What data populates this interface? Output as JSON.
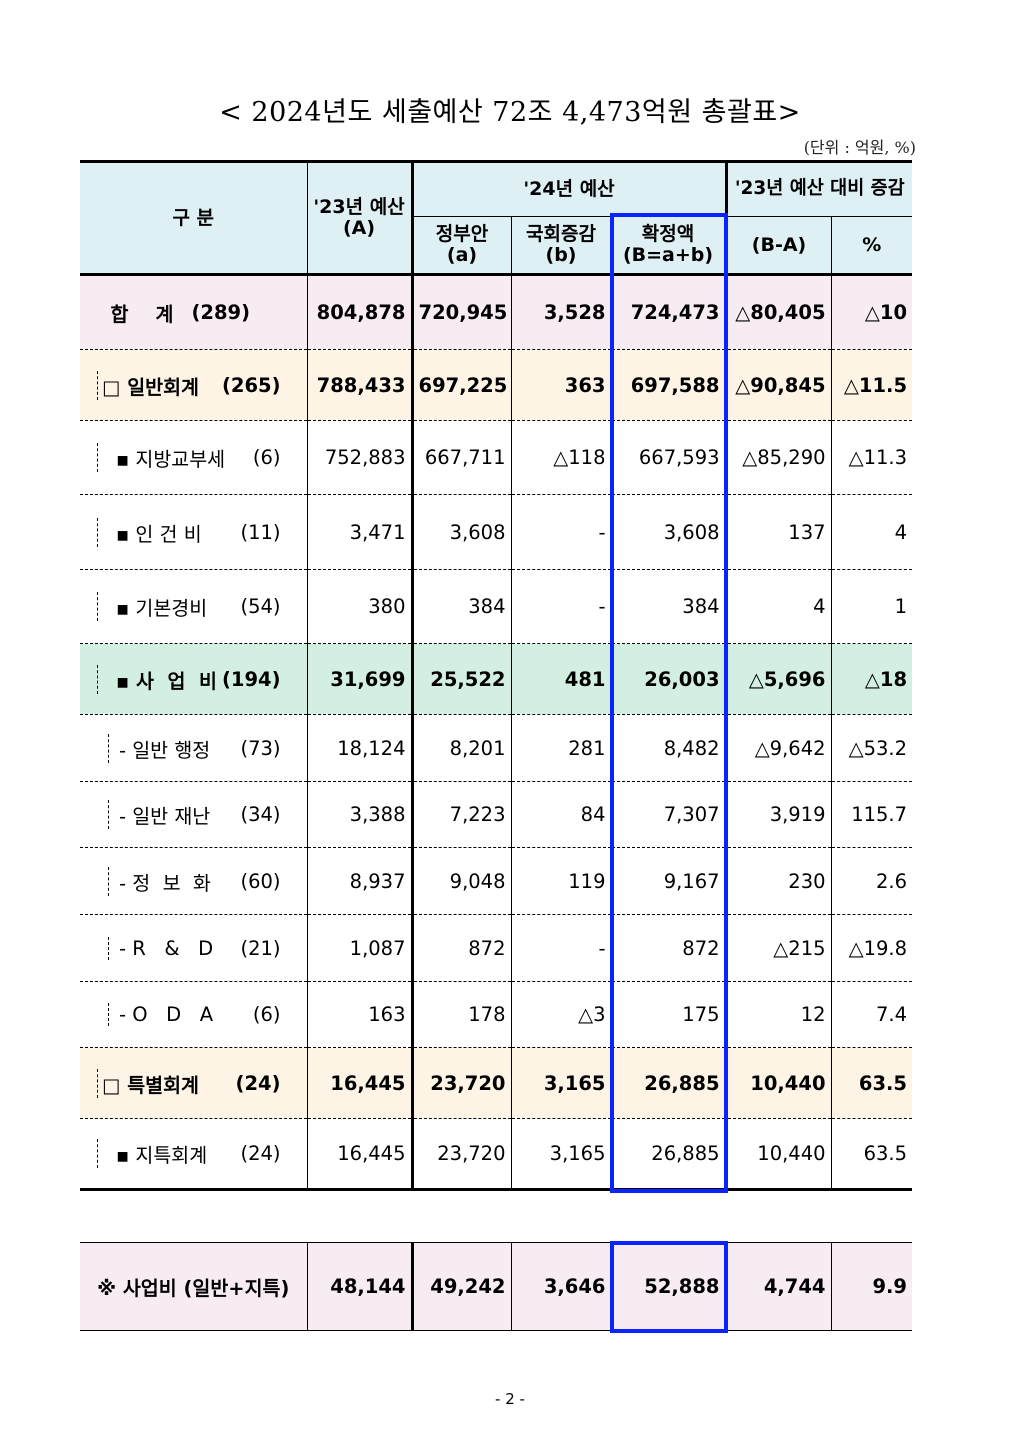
{
  "title": "< 2024년도 세출예산 72조 4,473억원 총괄표>",
  "unit": "(단위 : 억원, %)",
  "page_number": "- 2 -",
  "headers": {
    "category": "구   분",
    "prev_budget": "'23년 예산",
    "prev_budget_sub": "(A)",
    "budget_24": "'24년 예산",
    "change_vs_23": "'23년 예산 대비 증감",
    "gov": "정부안",
    "gov_sub": "(a)",
    "assembly": "국회증감",
    "assembly_sub": "(b)",
    "final": "확정액",
    "final_sub": "(B=a+b)",
    "diff": "(B-A)",
    "pct": "%"
  },
  "rows": [
    {
      "label": "합    계",
      "count": "(289)",
      "a": "804,878",
      "gov": "720,945",
      "asm": "3,528",
      "fin": "724,473",
      "diff": "△80,405",
      "pct": "△10"
    },
    {
      "label": "□ 일반회계",
      "count": "(265)",
      "a": "788,433",
      "gov": "697,225",
      "asm": "363",
      "fin": "697,588",
      "diff": "△90,845",
      "pct": "△11.5"
    },
    {
      "label": "▪ 지방교부세",
      "count": "(6)",
      "a": "752,883",
      "gov": "667,711",
      "asm": "△118",
      "fin": "667,593",
      "diff": "△85,290",
      "pct": "△11.3"
    },
    {
      "label": "▪ 인 건 비",
      "count": "(11)",
      "a": "3,471",
      "gov": "3,608",
      "asm": "-",
      "fin": "3,608",
      "diff": "137",
      "pct": "4"
    },
    {
      "label": "▪ 기본경비",
      "count": "(54)",
      "a": "380",
      "gov": "384",
      "asm": "-",
      "fin": "384",
      "diff": "4",
      "pct": "1"
    },
    {
      "label": "▪ 사  업  비",
      "count": "(194)",
      "a": "31,699",
      "gov": "25,522",
      "asm": "481",
      "fin": "26,003",
      "diff": "△5,696",
      "pct": "△18"
    },
    {
      "label": "- 일반 행정",
      "count": "(73)",
      "a": "18,124",
      "gov": "8,201",
      "asm": "281",
      "fin": "8,482",
      "diff": "△9,642",
      "pct": "△53.2"
    },
    {
      "label": "- 일반 재난",
      "count": "(34)",
      "a": "3,388",
      "gov": "7,223",
      "asm": "84",
      "fin": "7,307",
      "diff": "3,919",
      "pct": "115.7"
    },
    {
      "label": "- 정  보  화",
      "count": "(60)",
      "a": "8,937",
      "gov": "9,048",
      "asm": "119",
      "fin": "9,167",
      "diff": "230",
      "pct": "2.6"
    },
    {
      "label": "- R   &   D",
      "count": "(21)",
      "a": "1,087",
      "gov": "872",
      "asm": "-",
      "fin": "872",
      "diff": "△215",
      "pct": "△19.8"
    },
    {
      "label": "- O   D   A",
      "count": "(6)",
      "a": "163",
      "gov": "178",
      "asm": "△3",
      "fin": "175",
      "diff": "12",
      "pct": "7.4"
    },
    {
      "label": "□ 특별회계",
      "count": "(24)",
      "a": "16,445",
      "gov": "23,720",
      "asm": "3,165",
      "fin": "26,885",
      "diff": "10,440",
      "pct": "63.5"
    },
    {
      "label": "▪ 지특회계",
      "count": "(24)",
      "a": "16,445",
      "gov": "23,720",
      "asm": "3,165",
      "fin": "26,885",
      "diff": "10,440",
      "pct": "63.5"
    }
  ],
  "summary": {
    "label": "※ 사업비 (일반+지특)",
    "a": "48,144",
    "gov": "49,242",
    "asm": "3,646",
    "fin": "52,888",
    "diff": "4,744",
    "pct": "9.9"
  },
  "colors": {
    "highlight": "#0a24ff",
    "header_bg": "#dff0f5",
    "total_bg": "#f7ebf4",
    "account_bg": "#fdf4e6",
    "project_bg": "#d3efe2"
  }
}
